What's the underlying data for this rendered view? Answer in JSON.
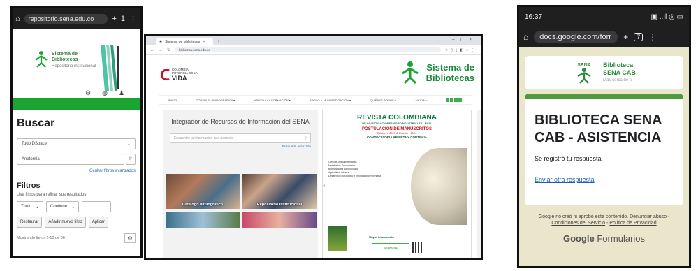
{
  "panel1": {
    "url": "repositorio.sena.edu.co",
    "tab_count": "1",
    "brand_line1": "Sistema de",
    "brand_line2": "Bibliotecas",
    "brand_sub": "Repositorio institucional",
    "search_heading": "Buscar",
    "scope_select": "Todo DSpace",
    "query_value": "Anatomía",
    "go_label": "Ir",
    "hide_advanced": "Ocultar filtros avanzados",
    "filters_heading": "Filtros",
    "filters_help": "Use filtros para refinar sus resultados.",
    "filter_field": "Título",
    "filter_op": "Contiene",
    "restore_button": "Restaurar",
    "add_filter_button": "Añadir nuevo filtro",
    "apply_button": "Aplicar",
    "results_info": "Mostrando ítems 1-10 de 86"
  },
  "panel2": {
    "tab_title": "Sistema de bibliotecas",
    "url": "biblioteca.sena.edu.co",
    "colombia_small": "COLOMBIA",
    "colombia_sub": "POTENCIA DE LA",
    "colombia_big": "VIDA",
    "sena_title_line1": "Sistema de",
    "sena_title_line2": "Bibliotecas",
    "menu": [
      "INICIO",
      "CONSULTA BIBLIOGRÁFICA ▾",
      "APOYO A LA FORMACIÓN ▾",
      "APOYO A LA INVESTIGACIÓN ▾",
      "QUIÉNES SOMOS ▾",
      "AYUDA ▾"
    ],
    "integrator_heading": "Integrador de Recursos de Información del SENA",
    "search_placeholder": "Encuentre la información que necesita",
    "advanced_search": "Búsqueda avanzada",
    "tile1_label": "Catálogo bibliográfico",
    "tile2_label": "Repositorio institucional",
    "magazine_title": "REVISTA COLOMBIANA",
    "magazine_subtitle": "DE INVESTIGACIONES AGROINDUSTRIALES - RCIA",
    "magazine_postulacion": "POSTULACIÓN DE MANUSCRITOS",
    "magazine_editions": "Edición II 2023 & Edición I 2024",
    "magazine_call": "CONVOCATORIA ABIERTA Y CONTINUA",
    "magazine_list": [
      "Ciencias Agroalimentarias",
      "Metabolitos Secundarios",
      "Biotecnología Agropecuaria",
      "Agricultura Urbana",
      "Desarrollo Tecnológico e Innovación Empresarial"
    ],
    "magazine_info": "Mayor información",
    "magazine_brand": "SENNOVA"
  },
  "panel3": {
    "time": "16:37",
    "status_right": "▣ ..ıl ◎ ▭",
    "url": "docs.google.com/forr",
    "tab_count": "7",
    "logo_line1": "Biblioteca",
    "logo_line2": "SENA CAB",
    "logo_sub": "Más cerca de ti",
    "form_title": "BIBLIOTECA SENA CAB - ASISTENCIA",
    "confirmation": "Se registró tu respuesta.",
    "another_response": "Enviar otra respuesta",
    "disclaimer_prefix": "Google no creó ni aprobó este contenido.",
    "report_abuse": "Denunciar abuso",
    "terms": "Condiciones del Servicio",
    "privacy": "Política de Privacidad",
    "brand_google": "Google",
    "brand_forms": "Formularios"
  },
  "colors": {
    "sena_green": "#1aa532",
    "form_accent": "#4e9a3c",
    "form_bg": "#eae6cc"
  }
}
